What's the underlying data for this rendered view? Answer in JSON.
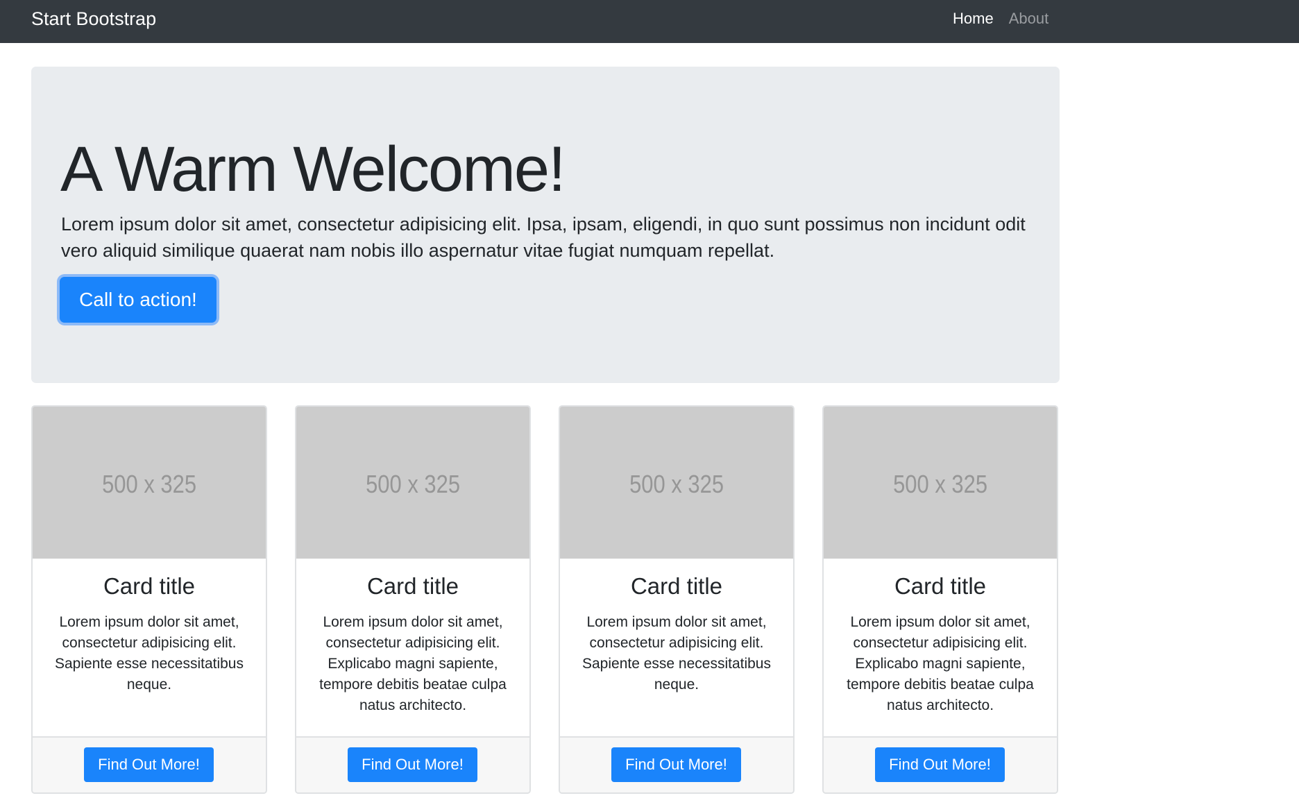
{
  "navbar": {
    "brand": "Start Bootstrap",
    "links": [
      {
        "label": "Home",
        "active": true
      },
      {
        "label": "About",
        "active": false
      }
    ]
  },
  "jumbotron": {
    "title": "A Warm Welcome!",
    "lead": "Lorem ipsum dolor sit amet, consectetur adipisicing elit. Ipsa, ipsam, eligendi, in quo sunt possimus non incidunt odit vero aliquid similique quaerat nam nobis illo aspernatur vitae fugiat numquam repellat.",
    "cta_label": "Call to action!"
  },
  "cards": [
    {
      "image_label": "500 x 325",
      "title": "Card title",
      "text": "Lorem ipsum dolor sit amet, consectetur adipisicing elit. Sapiente esse necessitatibus neque.",
      "button_label": "Find Out More!"
    },
    {
      "image_label": "500 x 325",
      "title": "Card title",
      "text": "Lorem ipsum dolor sit amet, consectetur adipisicing elit. Explicabo magni sapiente, tempore debitis beatae culpa natus architecto.",
      "button_label": "Find Out More!"
    },
    {
      "image_label": "500 x 325",
      "title": "Card title",
      "text": "Lorem ipsum dolor sit amet, consectetur adipisicing elit. Sapiente esse necessitatibus neque.",
      "button_label": "Find Out More!"
    },
    {
      "image_label": "500 x 325",
      "title": "Card title",
      "text": "Lorem ipsum dolor sit amet, consectetur adipisicing elit. Explicabo magni sapiente, tempore debitis beatae culpa natus architecto.",
      "button_label": "Find Out More!"
    }
  ],
  "colors": {
    "navbar_bg": "#343a40",
    "primary": "#1a84fb",
    "jumbotron_bg": "#e9ecef",
    "placeholder_bg": "#cccccc"
  }
}
